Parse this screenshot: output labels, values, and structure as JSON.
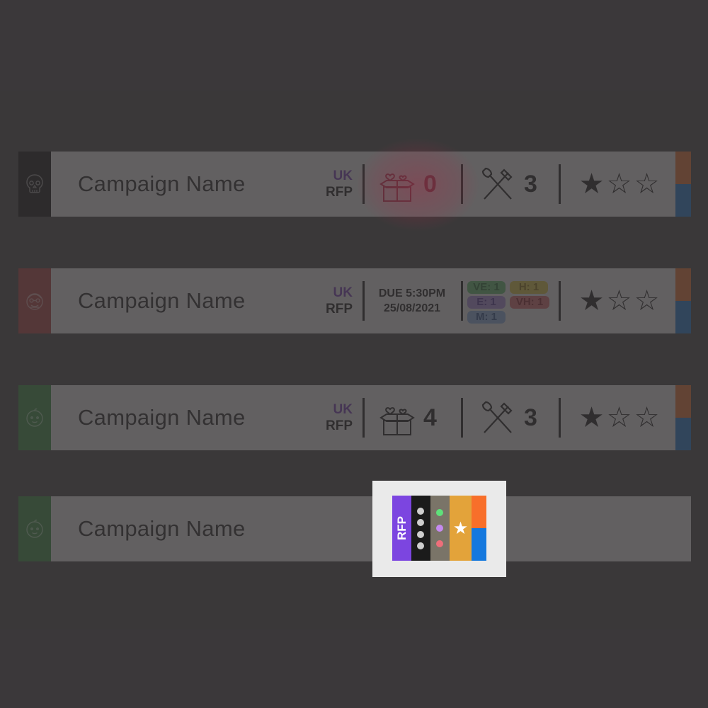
{
  "cards": [
    {
      "name": "Campaign Name",
      "icon": "skull-icon",
      "bar_color": "#000000",
      "region_top": "UK",
      "region_bottom": "RFP",
      "gifts": "0",
      "tools": "3",
      "stars": [
        "★",
        "☆",
        "☆"
      ]
    },
    {
      "name": "Campaign Name",
      "icon": "old-person-face-icon",
      "bar_color": "#b33a3a",
      "region_top": "UK",
      "region_bottom": "RFP",
      "due_line1": "DUE 5:30PM",
      "due_line2": "25/08/2021",
      "tags": {
        "ve": "VE: 1",
        "h": "H: 1",
        "e": "E: 1",
        "vh": "VH: 1",
        "m": "M: 1"
      },
      "stars": [
        "★",
        "☆",
        "☆"
      ]
    },
    {
      "name": "Campaign Name",
      "icon": "baby-face-icon",
      "bar_color": "#2f8f3a",
      "region_top": "UK",
      "region_bottom": "RFP",
      "gifts": "4",
      "tools": "3",
      "stars": [
        "★",
        "☆",
        "☆"
      ]
    },
    {
      "name": "Campaign Name",
      "icon": "baby-face-icon",
      "bar_color": "#2f8f3a"
    }
  ],
  "legend": {
    "label": "RFP",
    "star": "★"
  },
  "colors": {
    "purple": "#7433b8",
    "orange": "#f26f24",
    "blue": "#1476d6",
    "legend_purple": "#7c45e0",
    "legend_amber": "#e3a33a"
  }
}
